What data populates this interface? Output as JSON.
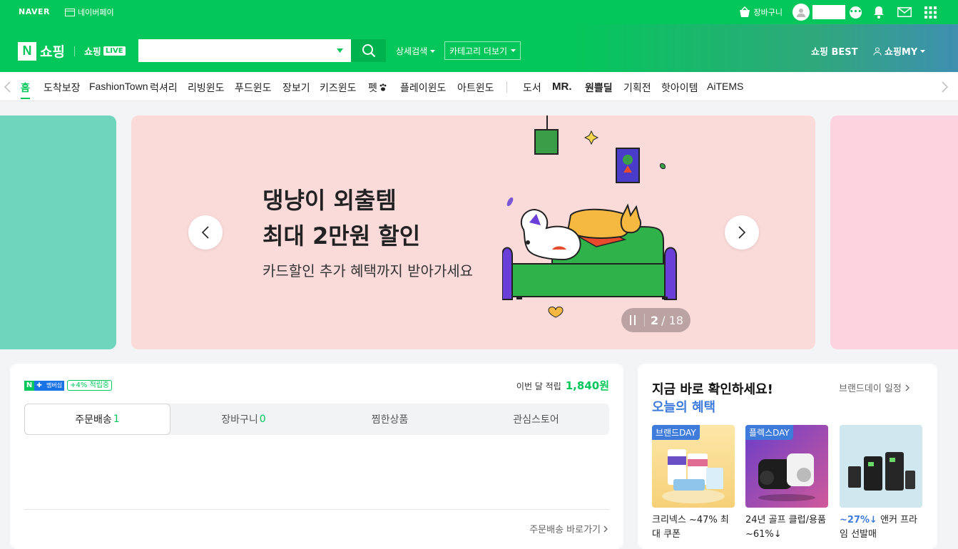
{
  "topbar": {
    "naver": "NAVER",
    "pay": "네이버페이",
    "cart": "장바구니"
  },
  "header": {
    "logo_n": "N",
    "logo_text": "쇼핑",
    "live_text": "쇼핑",
    "live_badge": "LIVE",
    "search_placeholder": "",
    "detail_search": "상세검색",
    "category_more": "카테고리 더보기",
    "best": "쇼핑 BEST",
    "my": "쇼핑MY"
  },
  "nav": {
    "items": [
      "홈",
      "도착보장",
      "FashionTown",
      "럭셔리",
      "리빙윈도",
      "푸드윈도",
      "장보기",
      "키즈윈도",
      "펫",
      "플레이윈도",
      "아트윈도",
      "도서",
      "MR.",
      "원쁠딜",
      "기획전",
      "핫아이템",
      "AiTEMS"
    ]
  },
  "banner": {
    "line1": "댕냥이 외출템",
    "line2": "최대 2만원 할인",
    "line3": "카드할인 추가 혜택까지 받아가세요",
    "page_current": "2",
    "page_total": "/ 18"
  },
  "membership": {
    "badge_n": "N",
    "badge_plus": "✚",
    "badge_label": "멤버십",
    "point_tag": "+4% 적립중",
    "month_label": "이번 달 적립",
    "month_value": "1,840원"
  },
  "tabs": {
    "items": [
      {
        "label": "주문배송",
        "count": "1"
      },
      {
        "label": "장바구니",
        "count": "0"
      },
      {
        "label": "찜한상품",
        "count": ""
      },
      {
        "label": "관심스토어",
        "count": ""
      }
    ]
  },
  "order_link": "주문배송 바로가기",
  "benefits": {
    "title": "지금 바로 확인하세요!",
    "subtitle": "오늘의 혜택",
    "schedule": "브랜드데이 일정",
    "products": [
      {
        "tag": "브랜드DAY",
        "desc_highlight": "",
        "desc": "크리넥스 ~47% 최대 쿠폰"
      },
      {
        "tag": "플렉스DAY",
        "desc_highlight": "",
        "desc": "24년 골프 클럽/용품 ~61%↓"
      },
      {
        "tag": "",
        "desc_highlight": "~27%↓",
        "desc": " 앤커 프라임 선발매"
      }
    ]
  },
  "colors": {
    "primary": "#03c75a",
    "tab_count": "#03c75a",
    "blue": "#3e7bdb"
  }
}
